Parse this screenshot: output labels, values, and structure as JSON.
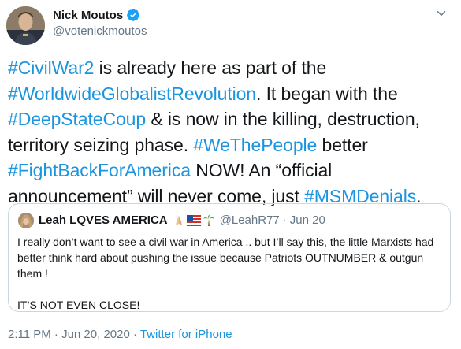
{
  "author": {
    "name": "Nick Moutos",
    "handle": "@votenickmoutos"
  },
  "tweet": {
    "segments": [
      {
        "text": "#CivilWar2",
        "tag": true
      },
      {
        "text": " is already here as part of the ",
        "tag": false
      },
      {
        "text": "#WorldwideGlobalistRevolution",
        "tag": true
      },
      {
        "text": ". It began with the ",
        "tag": false
      },
      {
        "text": "#DeepStateCoup",
        "tag": true
      },
      {
        "text": " & is now in the killing, destruction, territory seizing phase. ",
        "tag": false
      },
      {
        "text": "#WeThePeople",
        "tag": true
      },
      {
        "text": " better ",
        "tag": false
      },
      {
        "text": "#FightBackForAmerica",
        "tag": true
      },
      {
        "text": " NOW! An “official announcement” will never come, just ",
        "tag": false
      },
      {
        "text": "#MSMDenials",
        "tag": true
      },
      {
        "text": ".",
        "tag": false
      }
    ]
  },
  "quote": {
    "name": "Leah LQVES AMERICA",
    "handle": "@LeahR77",
    "separator": "·",
    "date": "Jun 20",
    "body_line1": "I really don’t want to see a civil war in America  .. but I’ll say this, the little Marxists had better think hard about pushing the issue because Patriots OUTNUMBER & outgun them !",
    "body_line2": "IT’S NOT EVEN CLOSE!"
  },
  "footer": {
    "timestamp": "2:11 PM · Jun 20, 2020 · ",
    "source": "Twitter for iPhone"
  },
  "colors": {
    "link": "#1b95e0",
    "muted": "#657786",
    "border": "#ccd6dd"
  },
  "icons": [
    "verified-badge-icon",
    "chevron-down-icon",
    "praying-hands-emoji",
    "us-flag-emoji",
    "palm-tree-emoji"
  ]
}
